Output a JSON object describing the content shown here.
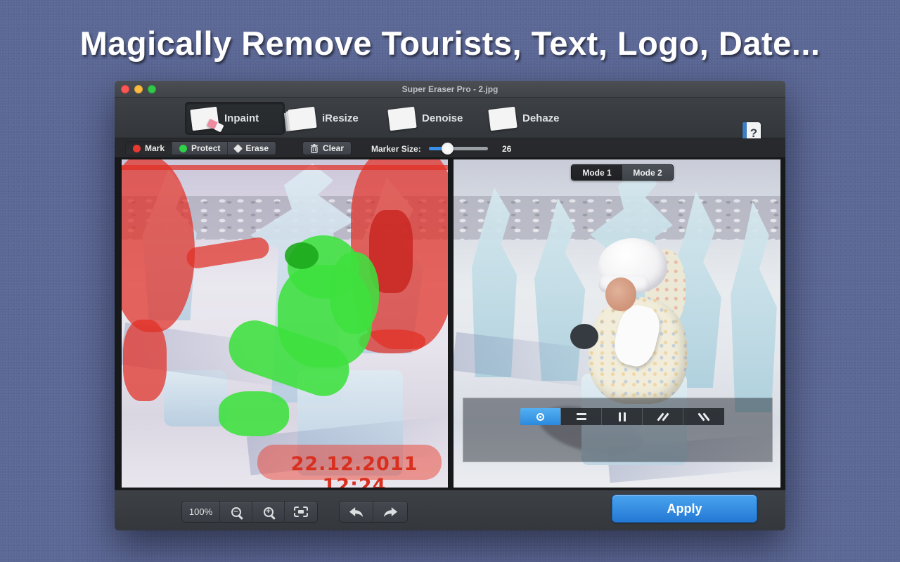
{
  "headline": "Magically Remove Tourists, Text, Logo, Date...",
  "window": {
    "title": "Super Eraser Pro - 2.jpg",
    "tabs": [
      {
        "label": "Inpaint",
        "selected": true
      },
      {
        "label": "iResize",
        "selected": false
      },
      {
        "label": "Denoise",
        "selected": false
      },
      {
        "label": "Dehaze",
        "selected": false
      }
    ],
    "help_glyph": "?",
    "tools": {
      "mark": "Mark",
      "protect": "Protect",
      "erase": "Erase",
      "clear": "Clear",
      "marker_size_label": "Marker Size:",
      "marker_size_value": "26"
    },
    "modes": {
      "mode1": "Mode 1",
      "mode2": "Mode 2"
    },
    "canvas": {
      "date_stamp": "22.12.2011 12:24"
    },
    "bottom": {
      "zoom_level": "100%",
      "apply": "Apply"
    }
  },
  "colors": {
    "desktop_background": "#5b6795",
    "accent_blue": "#2f8be4",
    "mark_red": "#e8392e",
    "protect_green": "#2ed147",
    "date_red": "#d92f1f",
    "apply_blue": "#2f8be4"
  },
  "icons": {
    "compare_selected": "target",
    "compare_modes": [
      "target",
      "horizontal-split",
      "vertical-split",
      "diagonal-left",
      "diagonal-right"
    ]
  }
}
